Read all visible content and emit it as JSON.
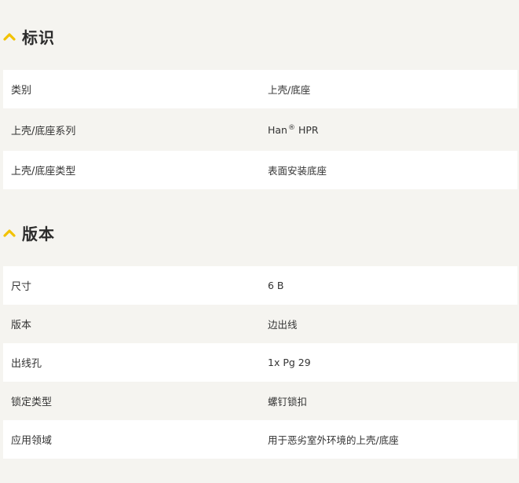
{
  "sections": [
    {
      "title": "标识",
      "rows": [
        {
          "label": "类别",
          "value": "上壳/底座"
        },
        {
          "label": "上壳/底座系列",
          "value": "Han",
          "value_sup": "®",
          "value_suffix": " HPR"
        },
        {
          "label": "上壳/底座类型",
          "value": "表面安装底座"
        }
      ]
    },
    {
      "title": "版本",
      "rows": [
        {
          "label": "尺寸",
          "value": "6 B"
        },
        {
          "label": "版本",
          "value": "边出线"
        },
        {
          "label": "出线孔",
          "value": "1x Pg 29"
        },
        {
          "label": "锁定类型",
          "value": "螺钉锁扣"
        },
        {
          "label": "应用领域",
          "value": "用于恶劣室外环境的上壳/底座"
        }
      ]
    }
  ],
  "colors": {
    "accent": "#f2c200",
    "page_background": "#f5f4f0",
    "row_white": "#ffffff",
    "text": "#333333"
  },
  "icons": {
    "section_toggle": "chevron-up-icon"
  }
}
